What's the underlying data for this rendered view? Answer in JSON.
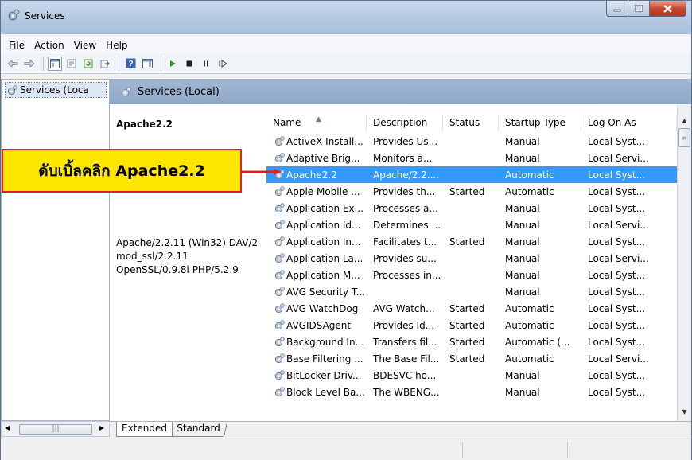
{
  "window": {
    "title": "Services"
  },
  "menu": [
    "File",
    "Action",
    "View",
    "Help"
  ],
  "tree": {
    "root_label": "Services (Loca"
  },
  "pane": {
    "header": "Services (Local)"
  },
  "detail": {
    "name": "Apache2.2",
    "description": "Apache/2.2.11 (Win32) DAV/2\nmod_ssl/2.2.11\nOpenSSL/0.9.8i PHP/5.2.9"
  },
  "columns": [
    "Name",
    "Description",
    "Status",
    "Startup Type",
    "Log On As"
  ],
  "services": [
    {
      "name": "ActiveX Install...",
      "description": "Provides Us...",
      "status": "",
      "startup": "Manual",
      "logon": "Local Syst..."
    },
    {
      "name": "Adaptive Brig...",
      "description": "Monitors a...",
      "status": "",
      "startup": "Manual",
      "logon": "Local Servi..."
    },
    {
      "name": "Apache2.2",
      "description": "Apache/2.2....",
      "status": "",
      "startup": "Automatic",
      "logon": "Local Syst..."
    },
    {
      "name": "Apple Mobile ...",
      "description": "Provides th...",
      "status": "Started",
      "startup": "Automatic",
      "logon": "Local Syst..."
    },
    {
      "name": "Application Ex...",
      "description": "Processes a...",
      "status": "",
      "startup": "Manual",
      "logon": "Local Syst..."
    },
    {
      "name": "Application Id...",
      "description": "Determines ...",
      "status": "",
      "startup": "Manual",
      "logon": "Local Servi..."
    },
    {
      "name": "Application In...",
      "description": "Facilitates t...",
      "status": "Started",
      "startup": "Manual",
      "logon": "Local Syst..."
    },
    {
      "name": "Application La...",
      "description": "Provides su...",
      "status": "",
      "startup": "Manual",
      "logon": "Local Servi..."
    },
    {
      "name": "Application M...",
      "description": "Processes in...",
      "status": "",
      "startup": "Manual",
      "logon": "Local Syst..."
    },
    {
      "name": "AVG Security T...",
      "description": "",
      "status": "",
      "startup": "Manual",
      "logon": "Local Syst..."
    },
    {
      "name": "AVG WatchDog",
      "description": "AVG Watch...",
      "status": "Started",
      "startup": "Automatic",
      "logon": "Local Syst..."
    },
    {
      "name": "AVGIDSAgent",
      "description": "Provides Id...",
      "status": "Started",
      "startup": "Automatic",
      "logon": "Local Syst..."
    },
    {
      "name": "Background In...",
      "description": "Transfers fil...",
      "status": "Started",
      "startup": "Automatic (...",
      "logon": "Local Syst..."
    },
    {
      "name": "Base Filtering ...",
      "description": "The Base Fil...",
      "status": "Started",
      "startup": "Automatic",
      "logon": "Local Servi..."
    },
    {
      "name": "BitLocker Driv...",
      "description": "BDESVC ho...",
      "status": "",
      "startup": "Manual",
      "logon": "Local Syst..."
    },
    {
      "name": "Block Level Ba...",
      "description": "The WBENG...",
      "status": "",
      "startup": "Manual",
      "logon": "Local Syst..."
    }
  ],
  "selected_index": 2,
  "tabs": {
    "extended": "Extended",
    "standard": "Standard"
  },
  "annotation": {
    "text": "ดับเบิ้ลคลิก Apache2.2",
    "box_color": "#ffe600",
    "border_color": "#e81d1d"
  },
  "colors": {
    "selection": "#3399ff",
    "header": "#9bb3cf"
  }
}
